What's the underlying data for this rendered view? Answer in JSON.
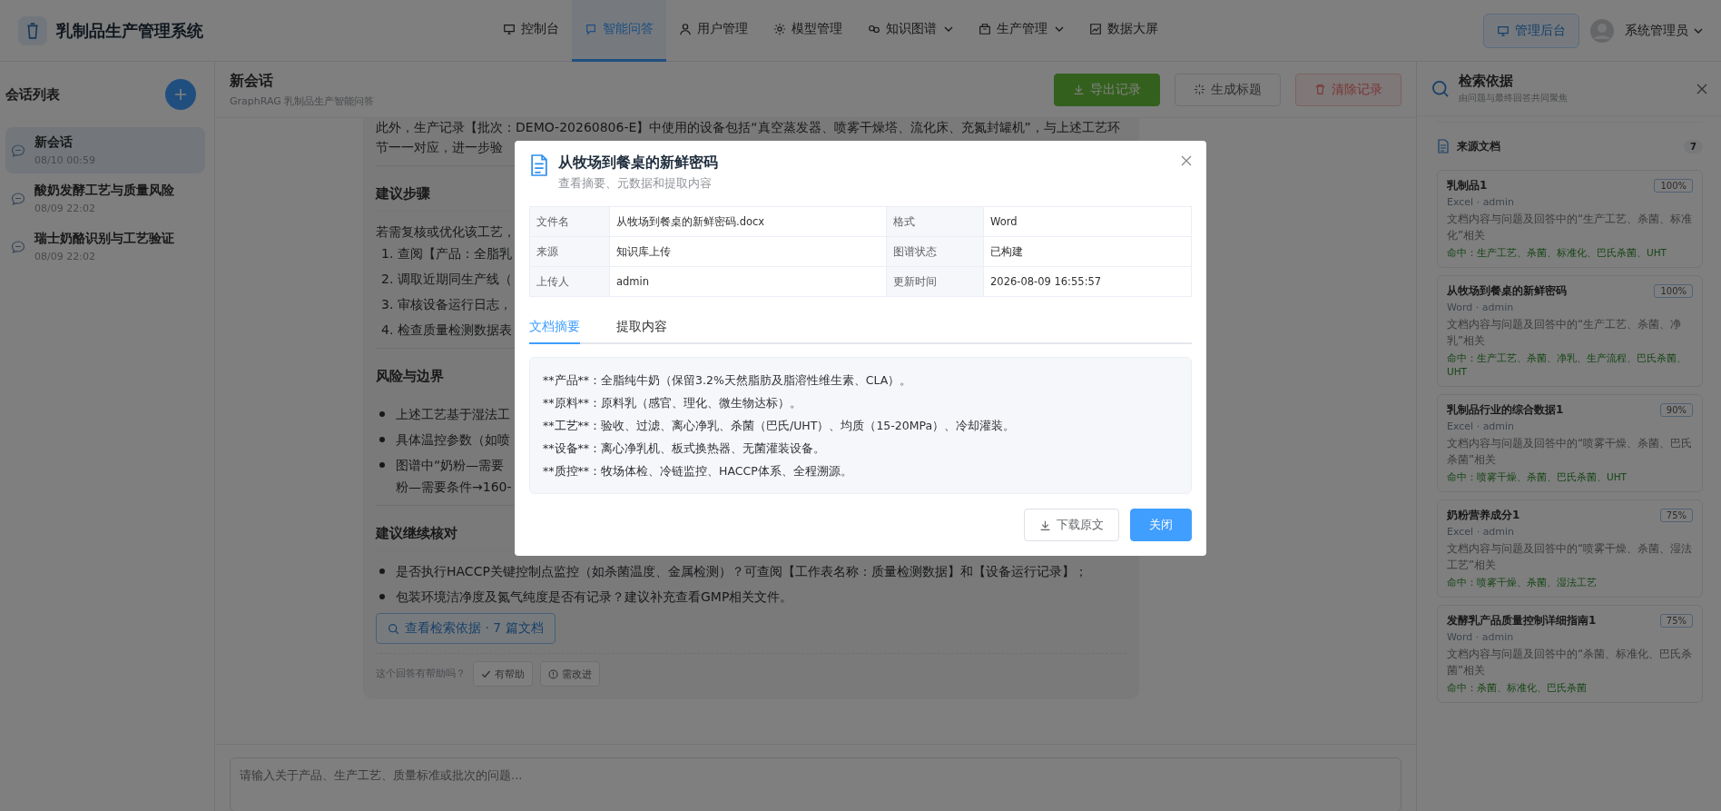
{
  "app": {
    "title": "乳制品生产管理系统"
  },
  "nav": [
    {
      "label": "控制台",
      "dropdown": false,
      "selected": false
    },
    {
      "label": "智能问答",
      "dropdown": false,
      "selected": true
    },
    {
      "label": "用户管理",
      "dropdown": false,
      "selected": false
    },
    {
      "label": "模型管理",
      "dropdown": false,
      "selected": false
    },
    {
      "label": "知识图谱",
      "dropdown": true,
      "selected": false
    },
    {
      "label": "生产管理",
      "dropdown": true,
      "selected": false
    },
    {
      "label": "数据大屏",
      "dropdown": false,
      "selected": false
    }
  ],
  "header_right": {
    "admin_button": "管理后台",
    "user": "系统管理员"
  },
  "sidebar": {
    "title": "会话列表",
    "sessions": [
      {
        "title": "新会话",
        "time": "08/10 00:59",
        "selected": true
      },
      {
        "title": "酸奶发酵工艺与质量风险",
        "time": "08/09 22:02",
        "selected": false
      },
      {
        "title": "瑞士奶酪识别与工艺验证",
        "time": "08/09 22:02",
        "selected": false
      }
    ]
  },
  "chat": {
    "title": "新会话",
    "subtitle": "GraphRAG 乳制品生产智能问答",
    "actions": [
      {
        "label": "导出记录",
        "kind": "success"
      },
      {
        "label": "生成标题",
        "kind": "plain"
      },
      {
        "label": "清除记录",
        "kind": "danger"
      }
    ],
    "content": [
      {
        "kind": "paragraph",
        "lines": [
          "此外，生产记录【批次：DEMO-20260806-E】中使用的设备包括“真空蒸发器、喷雾干燥塔、流化床、充氮封罐机”，与上述工艺环",
          "节一一对应，进一步验"
        ]
      },
      {
        "kind": "heading",
        "text": "建议步骤"
      },
      {
        "kind": "paragraph",
        "lines": [
          "若需复核或优化该工艺，"
        ]
      },
      {
        "kind": "ordered",
        "items": [
          {
            "number": "1.",
            "lines": [
              "查阅【产品：全脂乳"
            ]
          },
          {
            "number": "2.",
            "lines": [
              "调取近期同生产线（"
            ]
          },
          {
            "number": "3.",
            "lines": [
              "审核设备运行日志，"
            ]
          },
          {
            "number": "4.",
            "lines": [
              "检查质量检测数据表"
            ]
          }
        ]
      },
      {
        "kind": "heading",
        "text": "风险与边界"
      },
      {
        "kind": "bullets",
        "items": [
          {
            "lines": [
              "上述工艺基于湿法工"
            ]
          },
          {
            "lines": [
              "具体温控参数（如喷"
            ]
          },
          {
            "lines": [
              "图谱中“奶粉—需要",
              "粉—需要条件→160-"
            ]
          }
        ]
      },
      {
        "kind": "heading",
        "text": "建议继续核对"
      },
      {
        "kind": "bullets",
        "items": [
          {
            "lines": [
              "是否执行HACCP关键控制点监控（如杀菌温度、金属检测）？可查阅【工作表名称：质量检测数据】和【设备运行记录】；"
            ]
          },
          {
            "lines": [
              "包装环境洁净度及氮气纯度是否有记录？建议补充查看GMP相关文件。"
            ]
          }
        ]
      }
    ],
    "retrieval_button": "查看检索依据 · 7 篇文档",
    "feedback": {
      "question": "这个回答有帮助吗？",
      "helpful": "有帮助",
      "improve": "需改进"
    },
    "input": {
      "placeholder": "请输入关于产品、生产工艺、质量标准或批次的问题..."
    }
  },
  "evidence": {
    "title": "检索依据",
    "subtitle": "由问题与最终回答共同聚焦",
    "section": "来源文档",
    "count": "7",
    "docs": [
      {
        "title": "乳制品1",
        "score": "100%",
        "meta": "Excel · admin",
        "desc": "文档内容与问题及回答中的“生产工艺、杀菌、标准化”相关",
        "hits": "命中：生产工艺、杀菌、标准化、巴氏杀菌、UHT"
      },
      {
        "title": "从牧场到餐桌的新鲜密码",
        "score": "100%",
        "meta": "Word · admin",
        "desc": "文档内容与问题及回答中的“生产工艺、杀菌、净乳”相关",
        "hits": "命中：生产工艺、杀菌、净乳、生产流程、巴氏杀菌、UHT"
      },
      {
        "title": "乳制品行业的综合数据1",
        "score": "90%",
        "meta": "Excel · admin",
        "desc": "文档内容与问题及回答中的“喷雾干燥、杀菌、巴氏杀菌”相关",
        "hits": "命中：喷雾干燥、杀菌、巴氏杀菌、UHT"
      },
      {
        "title": "奶粉营养成分1",
        "score": "75%",
        "meta": "Excel · admin",
        "desc": "文档内容与问题及回答中的“喷雾干燥、杀菌、湿法工艺”相关",
        "hits": "命中：喷雾干燥、杀菌、湿法工艺"
      },
      {
        "title": "发酵乳产品质量控制详细指南1",
        "score": "75%",
        "meta": "Word · admin",
        "desc": "文档内容与问题及回答中的“杀菌、标准化、巴氏杀菌”相关",
        "hits": "命中：杀菌、标准化、巴氏杀菌"
      }
    ]
  },
  "modal": {
    "title": "从牧场到餐桌的新鲜密码",
    "subtitle": "查看摘要、元数据和提取内容",
    "meta": [
      [
        "文件名",
        "从牧场到餐桌的新鲜密码.docx",
        "格式",
        "Word"
      ],
      [
        "来源",
        "知识库上传",
        "图谱状态",
        "已构建"
      ],
      [
        "上传人",
        "admin",
        "更新时间",
        "2026-08-09 16:55:57"
      ]
    ],
    "tabs": [
      {
        "label": "文档摘要",
        "selected": true
      },
      {
        "label": "提取内容",
        "selected": false
      }
    ],
    "summary": [
      "**产品**：全脂纯牛奶（保留3.2%天然脂肪及脂溶性维生素、CLA）。",
      "**原料**：原料乳（感官、理化、微生物达标）。",
      "**工艺**：验收、过滤、离心净乳、杀菌（巴氏/UHT）、均质（15-20MPa）、冷却灌装。",
      "**设备**：离心净乳机、板式换热器、无菌灌装设备。",
      "**质控**：牧场体检、冷链监控、HACCP体系、全程溯源。"
    ],
    "buttons": [
      {
        "label": "下载原文",
        "kind": "plain"
      },
      {
        "label": "关闭",
        "kind": "primary"
      }
    ]
  }
}
